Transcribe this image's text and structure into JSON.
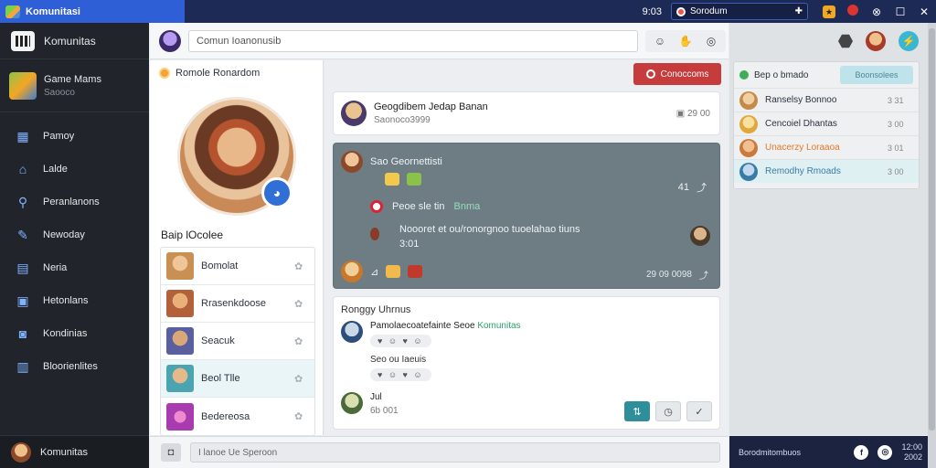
{
  "topbar": {
    "app_title": "Komunitasi",
    "user_label": "9:03",
    "search_value": "Sorodum"
  },
  "sidebar": {
    "header_title": "Komunitas",
    "game": {
      "title": "Game Mams",
      "subtitle": "Saooco"
    },
    "items": [
      {
        "label": "Pamoy",
        "icon": "store-icon"
      },
      {
        "label": "Lalde",
        "icon": "home-icon"
      },
      {
        "label": "Peranlanons",
        "icon": "search-icon"
      },
      {
        "label": "Newoday",
        "icon": "pen-icon"
      },
      {
        "label": "Neria",
        "icon": "calendar-icon"
      },
      {
        "label": "Hetonlans",
        "icon": "id-card-icon"
      },
      {
        "label": "Kondinias",
        "icon": "discord-icon"
      },
      {
        "label": "Bloorienlites",
        "icon": "chart-icon"
      }
    ],
    "footer_label": "Komunitas"
  },
  "composer": {
    "placeholder": "Comun Ioanonusib"
  },
  "profile": {
    "title": "Romole Ronardom",
    "section_label": "Baip lOcolee",
    "friends": [
      {
        "name": "Bomolat",
        "color": "#c99053"
      },
      {
        "name": "Rrasenkdoose",
        "color": "#b3613a"
      },
      {
        "name": "Seacuk",
        "color": "#5a5fa0"
      },
      {
        "name": "Beol Tlle",
        "color": "#4aa5b0"
      },
      {
        "name": "Bedereosa",
        "color": "#a83bb0"
      }
    ]
  },
  "feed": {
    "new_button": "Conoccoms",
    "card1": {
      "title": "Geogdibem Jedap Banan",
      "subtitle": "Saonoco3999",
      "meta": "29 00"
    },
    "card2": {
      "author": "Sao Geornettisti",
      "count": "41",
      "inner_title": "Peoe sle tin",
      "inner_highlight": "Bnma",
      "inner_text": "Noooret et ou/ronorgnoo tuoelahao tiuns",
      "inner_sub": "3:01",
      "meta": "29 09 0098"
    },
    "card3": {
      "label": "Ronggy Uhrnus",
      "comment1_text": "Pamolaecoatefainte Seoe",
      "comment1_highlight": "Komunitas",
      "comment1_reacts": "♥ ☺ ♥ ☺",
      "comment1_reply": "Seo ou Iaeuis",
      "comment1_reacts2": "♥ ☺ ♥ ☺",
      "comment2_name": "Jul",
      "comment2_meta": "6b 001"
    }
  },
  "right": {
    "online_title": "Bep o bmado",
    "join_label": "Boonsolees",
    "online": [
      {
        "name": "Ranselsy Bonnoo",
        "meta": "3 31",
        "color": "#c58a4a"
      },
      {
        "name": "Cencoiel Dhantas",
        "meta": "3 00",
        "color": "#e0a73a"
      },
      {
        "name": "Unacerzy Loraaoa",
        "meta": "3 01",
        "color": "#cc7a3a",
        "accent": "#e07b2a"
      },
      {
        "name": "Remodhy Rmoads",
        "meta": "3 00",
        "color": "#3a7ba5"
      }
    ]
  },
  "chatbar": {
    "placeholder": "I lanoe Ue Speroon"
  },
  "statusbar": {
    "label": "Borodmitombuos",
    "time": "12:00",
    "date": "2002"
  }
}
